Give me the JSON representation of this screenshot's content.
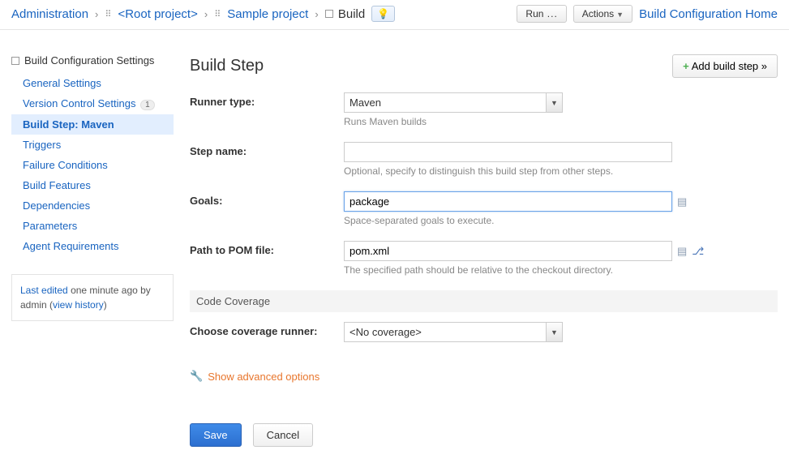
{
  "breadcrumbs": {
    "admin": "Administration",
    "root": "<Root project>",
    "sample": "Sample project",
    "build": "Build"
  },
  "topbar": {
    "run": "Run",
    "actions": "Actions",
    "home_link": "Build Configuration Home"
  },
  "sidebar": {
    "title": "Build Configuration Settings",
    "items": [
      {
        "label": "General Settings"
      },
      {
        "label": "Version Control Settings",
        "badge": "1"
      },
      {
        "label": "Build Step: Maven",
        "active": true
      },
      {
        "label": "Triggers"
      },
      {
        "label": "Failure Conditions"
      },
      {
        "label": "Build Features"
      },
      {
        "label": "Dependencies"
      },
      {
        "label": "Parameters"
      },
      {
        "label": "Agent Requirements"
      }
    ],
    "meta": {
      "last_edited_link": "Last edited",
      "last_edited_rest": "one minute ago by admin  (",
      "view_history": "view history",
      "close_paren": ")"
    }
  },
  "main": {
    "title": "Build Step",
    "add_build_step": "Add build step »",
    "runner_type": {
      "label": "Runner type:",
      "value": "Maven",
      "hint": "Runs Maven builds"
    },
    "step_name": {
      "label": "Step name:",
      "value": "",
      "hint": "Optional, specify to distinguish this build step from other steps."
    },
    "goals": {
      "label": "Goals:",
      "value": "package",
      "hint": "Space-separated goals to execute."
    },
    "pom": {
      "label": "Path to POM file:",
      "value": "pom.xml",
      "hint": "The specified path should be relative to the checkout directory."
    },
    "coverage_section": "Code Coverage",
    "coverage_runner": {
      "label": "Choose coverage runner:",
      "value": "<No coverage>"
    },
    "advanced": "Show advanced options",
    "save": "Save",
    "cancel": "Cancel"
  }
}
